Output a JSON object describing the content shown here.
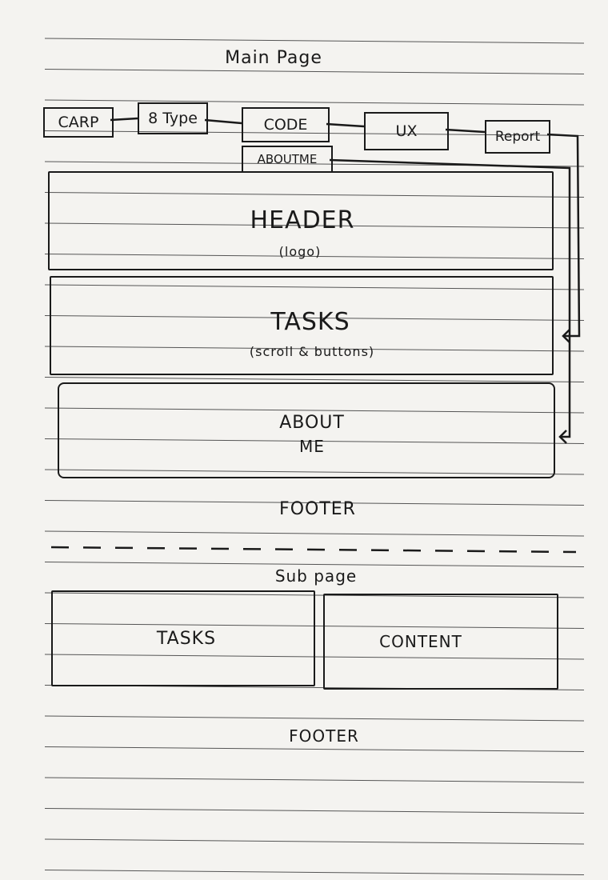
{
  "main_page": {
    "title": "Main Page",
    "nav": [
      "CARP",
      "8 Type",
      "CODE",
      "UX",
      "Report"
    ],
    "about_link": "ABOUTME",
    "header": {
      "label": "HEADER",
      "sub": "(logo)"
    },
    "tasks": {
      "label": "TASKS",
      "sub": "(scroll & buttons)"
    },
    "about": {
      "label": "ABOUT",
      "label2": "ME"
    },
    "footer": "FOOTER"
  },
  "sub_page": {
    "title": "Sub page",
    "tasks": "TASKS",
    "content": "CONTENT",
    "footer": "FOOTER"
  }
}
